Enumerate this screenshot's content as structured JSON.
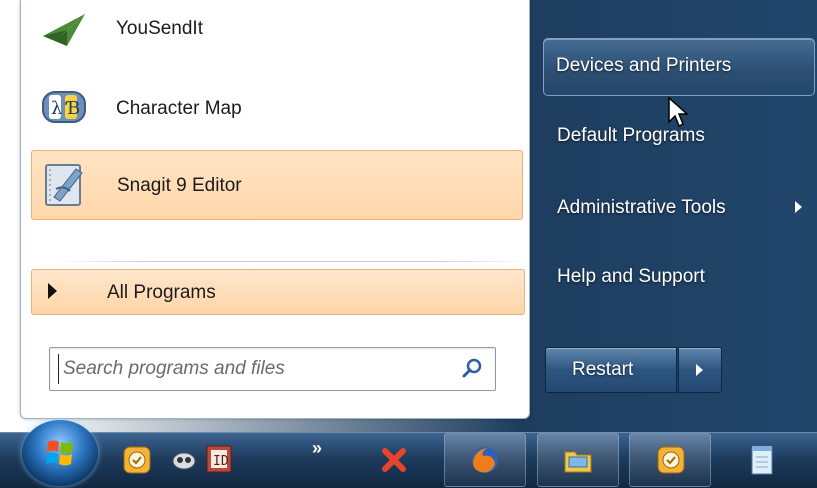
{
  "start_menu": {
    "programs": [
      {
        "label": "YouSendIt",
        "icon": "yousendit-icon"
      },
      {
        "label": "Character Map",
        "icon": "character-map-icon"
      },
      {
        "label": "Snagit 9 Editor",
        "icon": "snagit-editor-icon"
      }
    ],
    "all_programs_label": "All Programs",
    "search_placeholder": "Search programs and files",
    "right_items": [
      {
        "label": "Devices and Printers"
      },
      {
        "label": "Default Programs"
      },
      {
        "label": "Administrative Tools"
      },
      {
        "label": "Help and Support"
      }
    ],
    "restart_label": "Restart"
  },
  "taskbar": {
    "overflow_label": "»",
    "icons": [
      "windows-start-orb",
      "snagit-clock-icon",
      "mouse-icon",
      "tb-app-icon",
      "x-icon",
      "firefox-icon",
      "folder-icon",
      "snagit-icon",
      "notepad-icon"
    ]
  },
  "colors": {
    "right_pane": "#21466b",
    "highlight": "#ffd7ab",
    "taskbar": "#1e3c5e"
  }
}
